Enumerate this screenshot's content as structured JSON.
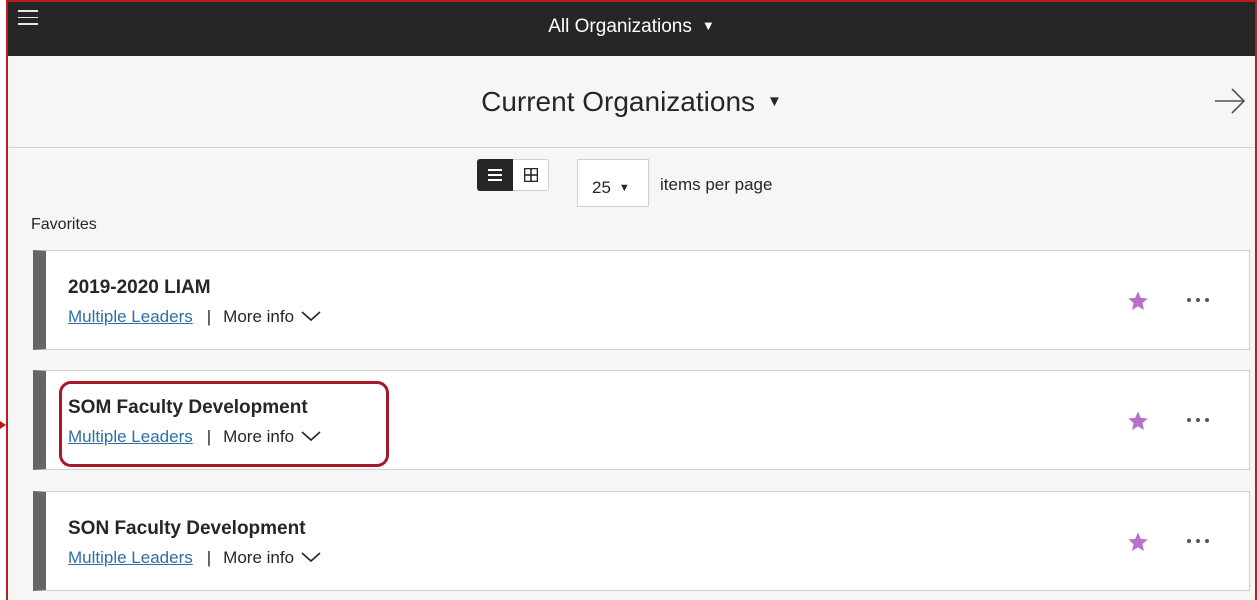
{
  "topbar": {
    "title": "All Organizations"
  },
  "subheader": {
    "title": "Current Organizations"
  },
  "controls": {
    "per_page_value": "25",
    "per_page_label": "items per page"
  },
  "section": {
    "favorites_label": "Favorites"
  },
  "organizations": [
    {
      "title": "2019-2020 LIAM",
      "leaders": "Multiple Leaders",
      "separator": "|",
      "more_info": "More info"
    },
    {
      "title": "SOM Faculty Development",
      "leaders": "Multiple Leaders",
      "separator": "|",
      "more_info": "More info"
    },
    {
      "title": "SON Faculty Development",
      "leaders": "Multiple Leaders",
      "separator": "|",
      "more_info": "More info"
    }
  ],
  "colors": {
    "topbar_bg": "#262626",
    "star": "#b871c9",
    "link": "#2c6fa5",
    "highlight": "#a51a24",
    "card_accent": "#666666"
  },
  "icons": [
    "hamburger-icon",
    "caret-down-icon",
    "arrow-right-icon",
    "list-view-icon",
    "grid-view-icon",
    "chevron-down-icon",
    "star-icon",
    "more-options-icon"
  ]
}
